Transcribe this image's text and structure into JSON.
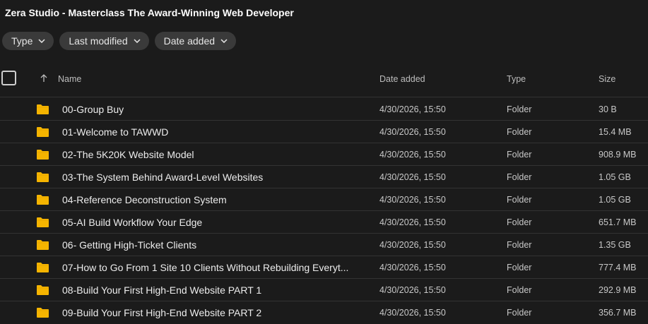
{
  "title": "Zera Studio - Masterclass The Award-Winning Web Developer",
  "filters": [
    {
      "label": "Type"
    },
    {
      "label": "Last modified"
    },
    {
      "label": "Date added"
    }
  ],
  "columns": {
    "name": "Name",
    "date_added": "Date added",
    "type": "Type",
    "size": "Size"
  },
  "icons": {
    "folder": "folder-icon",
    "sort": "arrow-up-icon",
    "chevron": "chevron-down-icon",
    "folder_color": "#f5b400"
  },
  "rows": [
    {
      "name": "00-Group Buy",
      "date": "4/30/2026, 15:50",
      "type": "Folder",
      "size": "30 B"
    },
    {
      "name": "01-Welcome to TAWWD",
      "date": "4/30/2026, 15:50",
      "type": "Folder",
      "size": "15.4 MB"
    },
    {
      "name": "02-The 5K20K Website Model",
      "date": "4/30/2026, 15:50",
      "type": "Folder",
      "size": "908.9 MB"
    },
    {
      "name": "03-The System Behind Award-Level Websites",
      "date": "4/30/2026, 15:50",
      "type": "Folder",
      "size": "1.05 GB"
    },
    {
      "name": "04-Reference Deconstruction System",
      "date": "4/30/2026, 15:50",
      "type": "Folder",
      "size": "1.05 GB"
    },
    {
      "name": "05-AI Build Workflow Your Edge",
      "date": "4/30/2026, 15:50",
      "type": "Folder",
      "size": "651.7 MB"
    },
    {
      "name": "06- Getting High-Ticket Clients",
      "date": "4/30/2026, 15:50",
      "type": "Folder",
      "size": "1.35 GB"
    },
    {
      "name": "07-How to Go From 1 Site 10 Clients Without Rebuilding Everyt...",
      "date": "4/30/2026, 15:50",
      "type": "Folder",
      "size": "777.4 MB"
    },
    {
      "name": "08-Build Your First High-End Website PART 1",
      "date": "4/30/2026, 15:50",
      "type": "Folder",
      "size": "292.9 MB"
    },
    {
      "name": "09-Build Your First High-End Website PART 2",
      "date": "4/30/2026, 15:50",
      "type": "Folder",
      "size": "356.7 MB"
    }
  ]
}
